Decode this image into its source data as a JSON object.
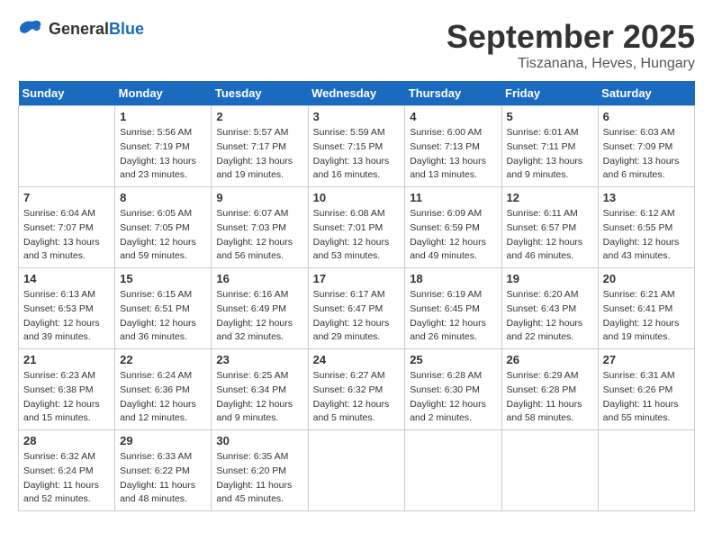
{
  "logo": {
    "general": "General",
    "blue": "Blue"
  },
  "header": {
    "month": "September 2025",
    "location": "Tiszanana, Heves, Hungary"
  },
  "days_of_week": [
    "Sunday",
    "Monday",
    "Tuesday",
    "Wednesday",
    "Thursday",
    "Friday",
    "Saturday"
  ],
  "weeks": [
    [
      {
        "day": "",
        "info": ""
      },
      {
        "day": "1",
        "info": "Sunrise: 5:56 AM\nSunset: 7:19 PM\nDaylight: 13 hours\nand 23 minutes."
      },
      {
        "day": "2",
        "info": "Sunrise: 5:57 AM\nSunset: 7:17 PM\nDaylight: 13 hours\nand 19 minutes."
      },
      {
        "day": "3",
        "info": "Sunrise: 5:59 AM\nSunset: 7:15 PM\nDaylight: 13 hours\nand 16 minutes."
      },
      {
        "day": "4",
        "info": "Sunrise: 6:00 AM\nSunset: 7:13 PM\nDaylight: 13 hours\nand 13 minutes."
      },
      {
        "day": "5",
        "info": "Sunrise: 6:01 AM\nSunset: 7:11 PM\nDaylight: 13 hours\nand 9 minutes."
      },
      {
        "day": "6",
        "info": "Sunrise: 6:03 AM\nSunset: 7:09 PM\nDaylight: 13 hours\nand 6 minutes."
      }
    ],
    [
      {
        "day": "7",
        "info": "Sunrise: 6:04 AM\nSunset: 7:07 PM\nDaylight: 13 hours\nand 3 minutes."
      },
      {
        "day": "8",
        "info": "Sunrise: 6:05 AM\nSunset: 7:05 PM\nDaylight: 12 hours\nand 59 minutes."
      },
      {
        "day": "9",
        "info": "Sunrise: 6:07 AM\nSunset: 7:03 PM\nDaylight: 12 hours\nand 56 minutes."
      },
      {
        "day": "10",
        "info": "Sunrise: 6:08 AM\nSunset: 7:01 PM\nDaylight: 12 hours\nand 53 minutes."
      },
      {
        "day": "11",
        "info": "Sunrise: 6:09 AM\nSunset: 6:59 PM\nDaylight: 12 hours\nand 49 minutes."
      },
      {
        "day": "12",
        "info": "Sunrise: 6:11 AM\nSunset: 6:57 PM\nDaylight: 12 hours\nand 46 minutes."
      },
      {
        "day": "13",
        "info": "Sunrise: 6:12 AM\nSunset: 6:55 PM\nDaylight: 12 hours\nand 43 minutes."
      }
    ],
    [
      {
        "day": "14",
        "info": "Sunrise: 6:13 AM\nSunset: 6:53 PM\nDaylight: 12 hours\nand 39 minutes."
      },
      {
        "day": "15",
        "info": "Sunrise: 6:15 AM\nSunset: 6:51 PM\nDaylight: 12 hours\nand 36 minutes."
      },
      {
        "day": "16",
        "info": "Sunrise: 6:16 AM\nSunset: 6:49 PM\nDaylight: 12 hours\nand 32 minutes."
      },
      {
        "day": "17",
        "info": "Sunrise: 6:17 AM\nSunset: 6:47 PM\nDaylight: 12 hours\nand 29 minutes."
      },
      {
        "day": "18",
        "info": "Sunrise: 6:19 AM\nSunset: 6:45 PM\nDaylight: 12 hours\nand 26 minutes."
      },
      {
        "day": "19",
        "info": "Sunrise: 6:20 AM\nSunset: 6:43 PM\nDaylight: 12 hours\nand 22 minutes."
      },
      {
        "day": "20",
        "info": "Sunrise: 6:21 AM\nSunset: 6:41 PM\nDaylight: 12 hours\nand 19 minutes."
      }
    ],
    [
      {
        "day": "21",
        "info": "Sunrise: 6:23 AM\nSunset: 6:38 PM\nDaylight: 12 hours\nand 15 minutes."
      },
      {
        "day": "22",
        "info": "Sunrise: 6:24 AM\nSunset: 6:36 PM\nDaylight: 12 hours\nand 12 minutes."
      },
      {
        "day": "23",
        "info": "Sunrise: 6:25 AM\nSunset: 6:34 PM\nDaylight: 12 hours\nand 9 minutes."
      },
      {
        "day": "24",
        "info": "Sunrise: 6:27 AM\nSunset: 6:32 PM\nDaylight: 12 hours\nand 5 minutes."
      },
      {
        "day": "25",
        "info": "Sunrise: 6:28 AM\nSunset: 6:30 PM\nDaylight: 12 hours\nand 2 minutes."
      },
      {
        "day": "26",
        "info": "Sunrise: 6:29 AM\nSunset: 6:28 PM\nDaylight: 11 hours\nand 58 minutes."
      },
      {
        "day": "27",
        "info": "Sunrise: 6:31 AM\nSunset: 6:26 PM\nDaylight: 11 hours\nand 55 minutes."
      }
    ],
    [
      {
        "day": "28",
        "info": "Sunrise: 6:32 AM\nSunset: 6:24 PM\nDaylight: 11 hours\nand 52 minutes."
      },
      {
        "day": "29",
        "info": "Sunrise: 6:33 AM\nSunset: 6:22 PM\nDaylight: 11 hours\nand 48 minutes."
      },
      {
        "day": "30",
        "info": "Sunrise: 6:35 AM\nSunset: 6:20 PM\nDaylight: 11 hours\nand 45 minutes."
      },
      {
        "day": "",
        "info": ""
      },
      {
        "day": "",
        "info": ""
      },
      {
        "day": "",
        "info": ""
      },
      {
        "day": "",
        "info": ""
      }
    ]
  ]
}
